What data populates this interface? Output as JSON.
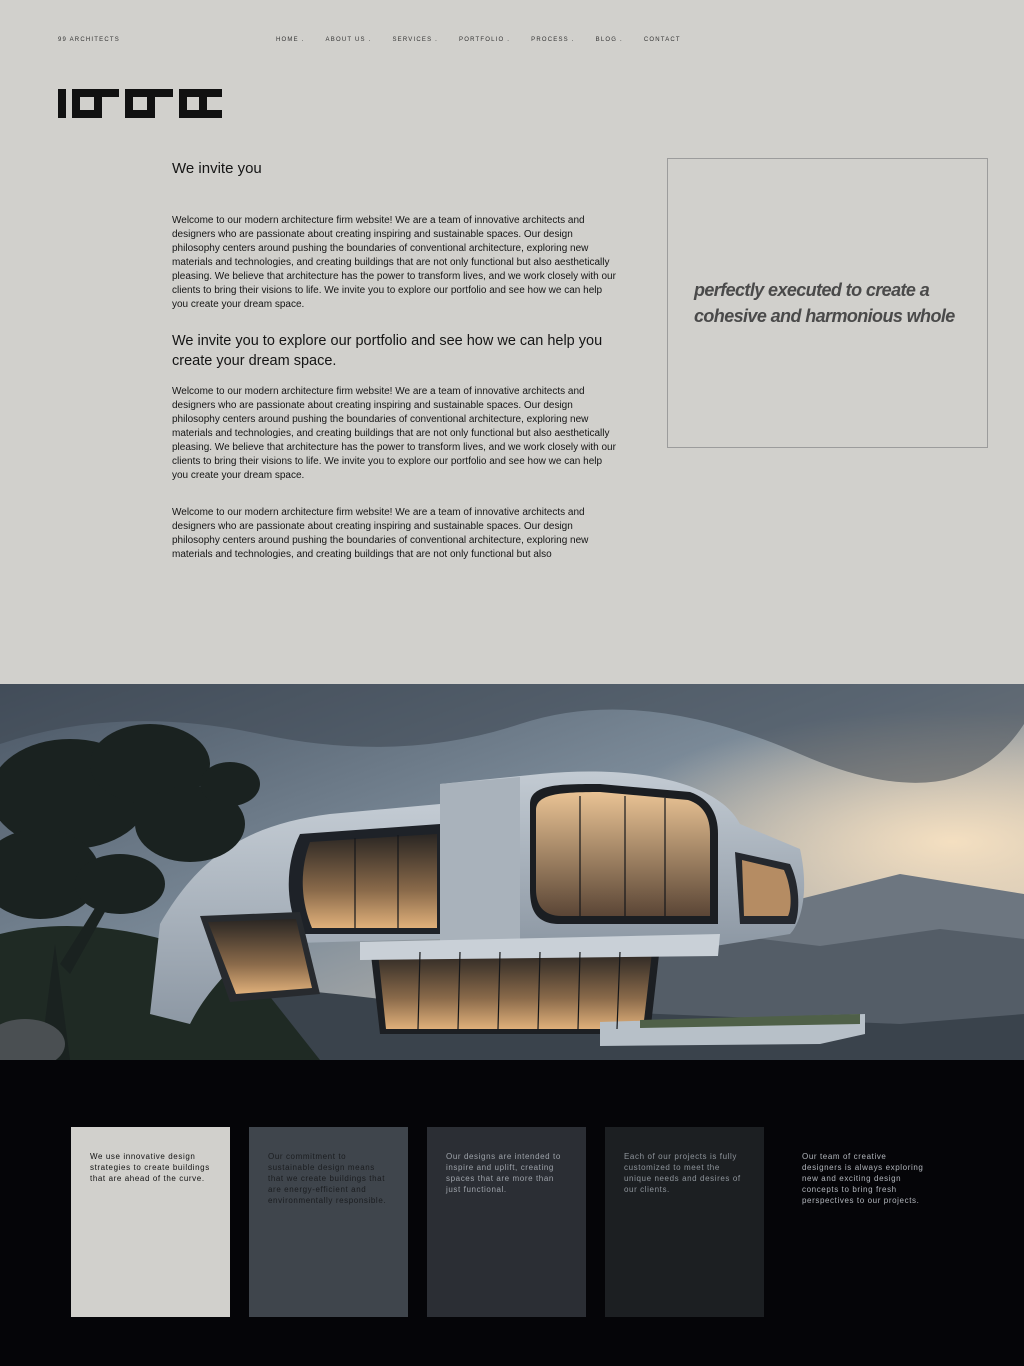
{
  "header": {
    "brand": "99 ARCHITECTS",
    "nav": [
      "HOME .",
      "ABOUT US .",
      "SERVICES .",
      "PORTFOLIO .",
      "PROCESS .",
      "BLOG .",
      "CONTACT"
    ]
  },
  "main": {
    "heading": "We invite you",
    "paragraph1": "Welcome to our modern architecture firm website! We are a team of innovative architects and designers who are passionate about creating inspiring and sustainable spaces. Our design philosophy centers around pushing the boundaries of conventional architecture, exploring new materials and technologies, and creating buildings that are not only functional but also aesthetically pleasing. We believe that architecture has the power to transform lives, and we work closely with our clients to bring their visions to life. We invite you to explore our portfolio and see how we can help you create your dream space.",
    "subheading": "We invite you to explore our portfolio and see how we can help you create your dream space.",
    "paragraph2": "Welcome to our modern architecture firm website! We are a team of innovative architects and designers who are passionate about creating inspiring and sustainable spaces. Our design philosophy centers around pushing the boundaries of conventional architecture, exploring new materials and technologies, and creating buildings that are not only functional but also aesthetically pleasing. We believe that architecture has the power to transform lives, and we work closely with our clients to bring their visions to life. We invite you to explore our portfolio and see how we can help you create your dream space.",
    "paragraph3": "Welcome to our modern architecture firm website! We are a team of innovative architects and designers who are passionate about creating inspiring and sustainable spaces. Our design philosophy centers around pushing the boundaries of conventional architecture, exploring new materials and technologies, and creating buildings that are not only functional but also"
  },
  "quote": "perfectly executed to create a cohesive and harmonious whole",
  "features": [
    "We use innovative design strategies to create buildings that are ahead of the curve.",
    "Our commitment to sustainable design means that we create buildings that are energy-efficient and environmentally responsible.",
    "Our designs are intended to inspire and uplift, creating spaces that are more than just functional.",
    "Each of our projects is fully customized to meet the unique needs and desires of our clients.",
    "Our team of creative designers is always exploring new and exciting design concepts to bring fresh perspectives to our projects."
  ],
  "colors": {
    "page_bg": "#d1d0cc",
    "footer_bg": "#050508",
    "text": "#111111"
  }
}
